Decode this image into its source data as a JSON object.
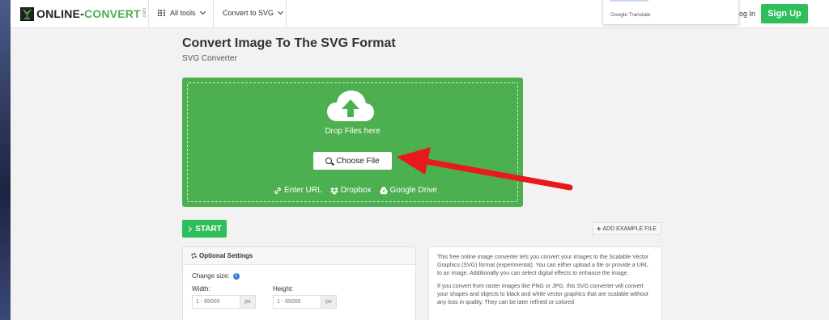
{
  "header": {
    "logo_text_1": "ONLINE-",
    "logo_text_2": "CONVERT",
    "logo_tld": ".com",
    "all_tools_label": "All tools",
    "convert_to_label": "Convert to SVG",
    "translate_label": "Google Translate",
    "login_label": "og In",
    "signup_label": "Sign Up"
  },
  "page": {
    "title": "Convert Image To The SVG Format",
    "subtitle": "SVG Converter"
  },
  "dropzone": {
    "drop_text": "Drop Files here",
    "choose_label": "Choose File",
    "sources": [
      {
        "icon": "link-icon",
        "label": "Enter URL"
      },
      {
        "icon": "dropbox-icon",
        "label": "Dropbox"
      },
      {
        "icon": "google-drive-icon",
        "label": "Google Drive"
      }
    ]
  },
  "actions": {
    "start_label": "START",
    "example_label": "ADD EXAMPLE FILE"
  },
  "settings": {
    "heading": "Optional Settings",
    "change_size_label": "Change size:",
    "width_label": "Width:",
    "height_label": "Height:",
    "width_placeholder": "1 - 65000",
    "height_placeholder": "1 - 65000",
    "unit": "px"
  },
  "description": {
    "paragraph_1": "This free online image converter lets you convert your images to the Scalable Vector Graphics (SVG) format (experimental). You can either upload a file or provide a URL to an image. Additionally you can select digital effects to enhance the image.",
    "paragraph_2": "If you convert from raster images like PNG or JPG, this SVG converter will convert your shapes and objects to black and white vector graphics that are scalable without any loss in quality. They can be later refined or colored"
  },
  "colors": {
    "brand_green": "#4caf50",
    "button_green": "#2ebf5a",
    "arrow_red": "#e8191b"
  }
}
